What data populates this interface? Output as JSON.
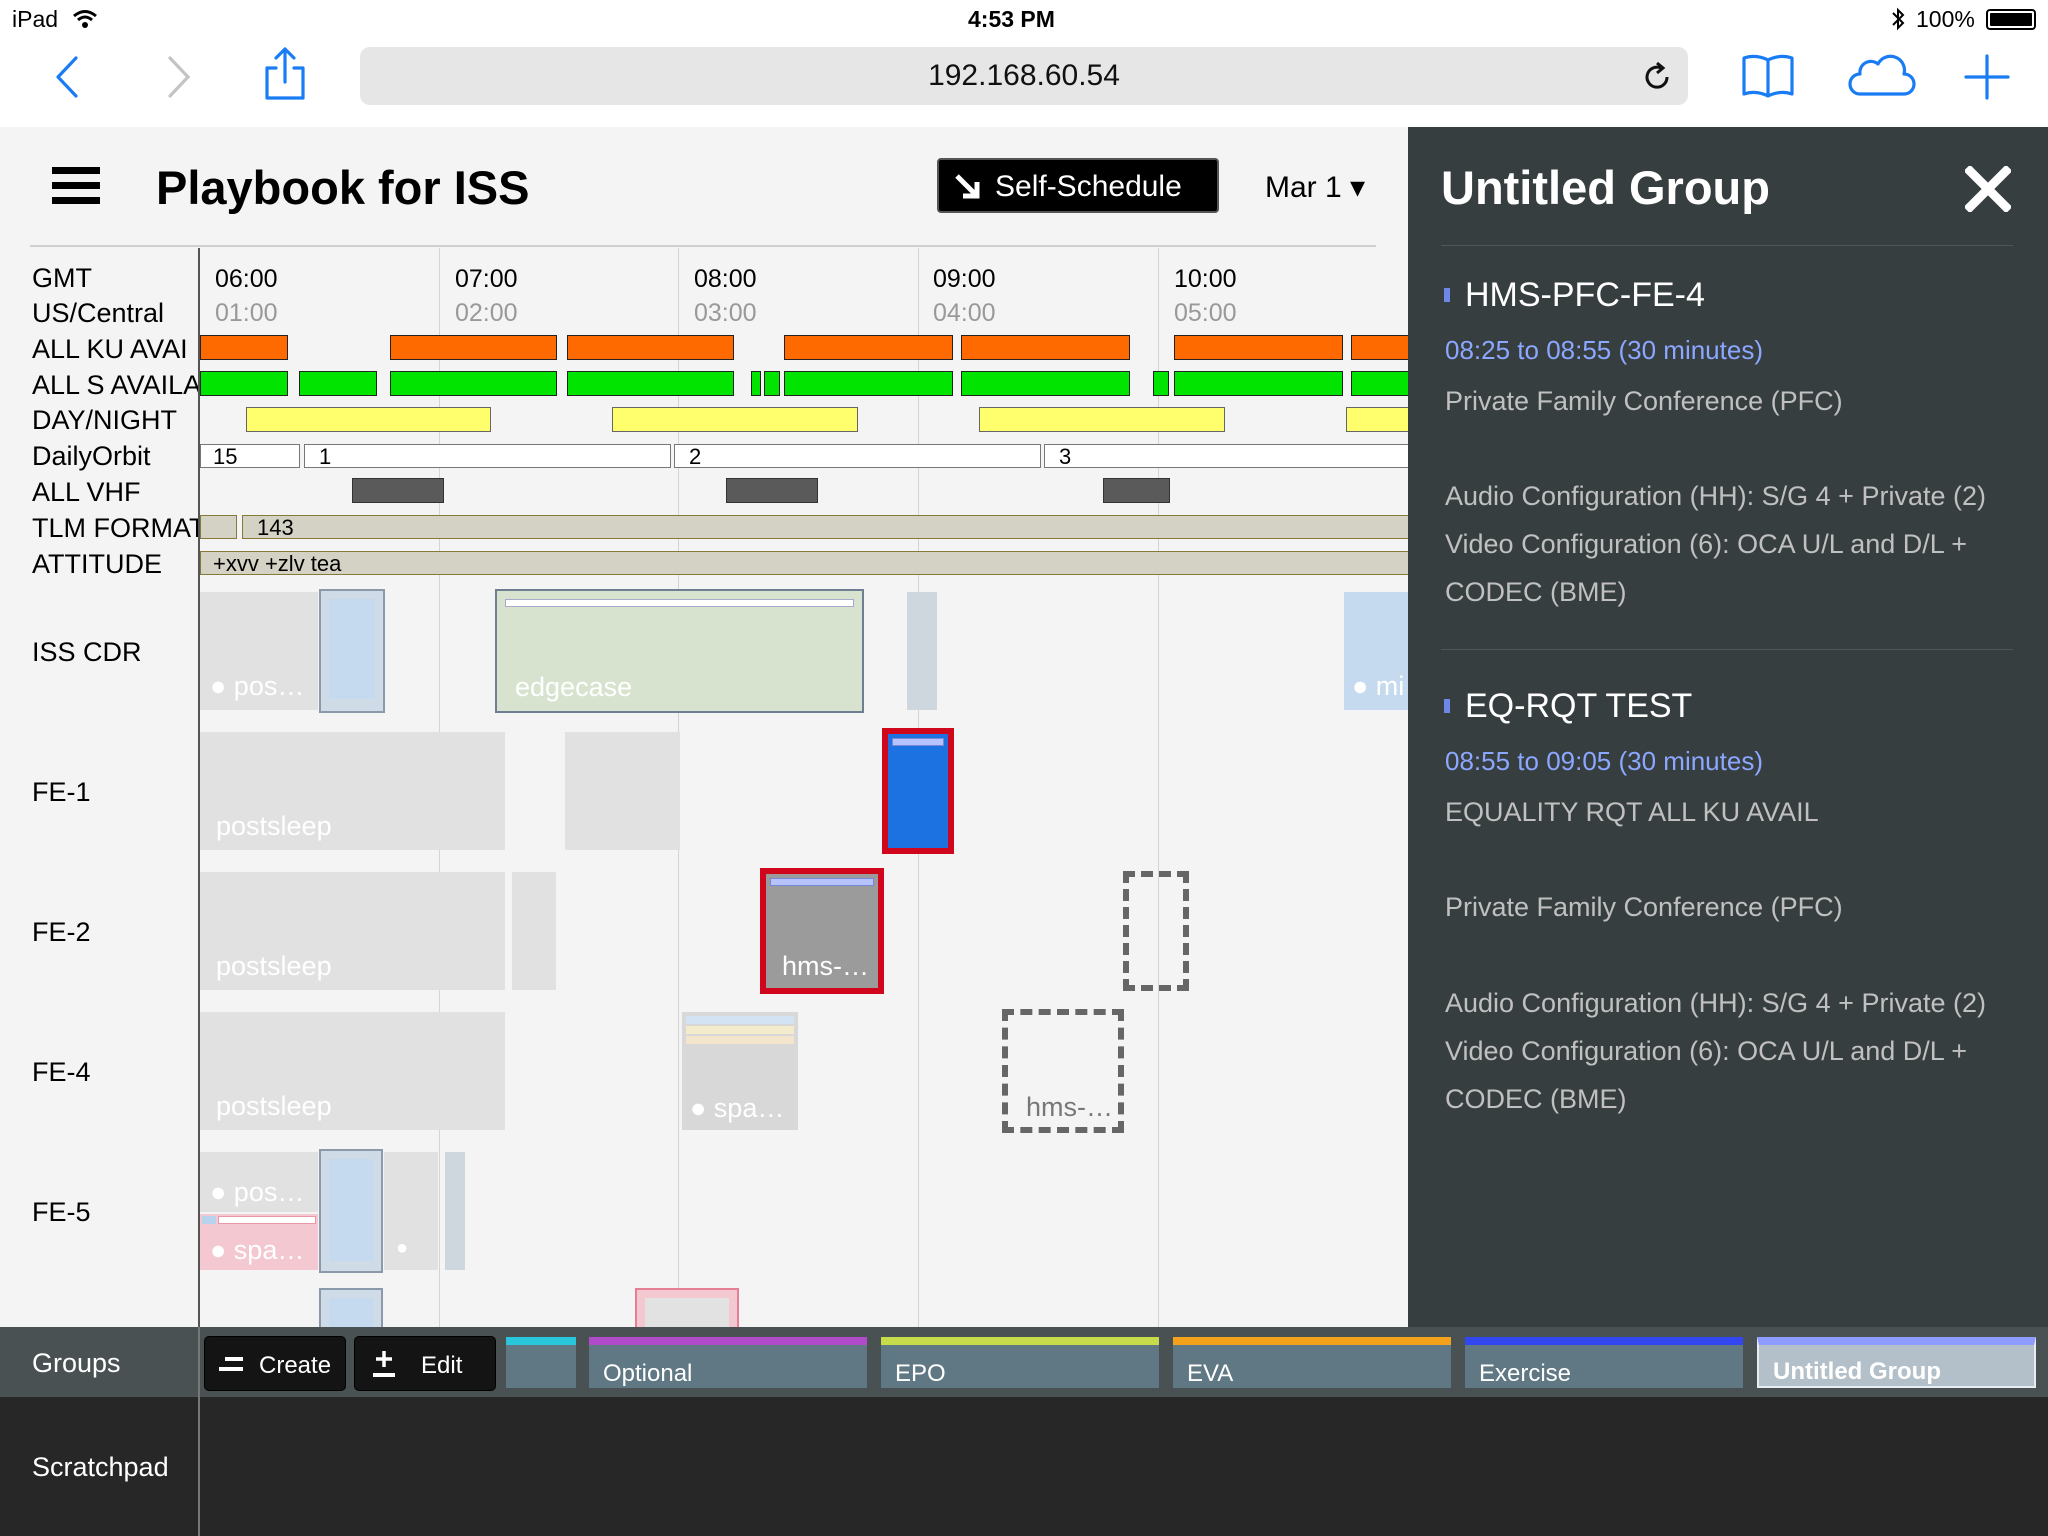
{
  "status_bar": {
    "device": "iPad",
    "time": "4:53 PM",
    "battery": "100%",
    "icons": [
      "wifi-icon",
      "bluetooth-icon",
      "battery-icon"
    ]
  },
  "browser": {
    "url": "192.168.60.54",
    "icons": [
      "back-arrow-icon",
      "forward-arrow-icon",
      "share-icon",
      "reload-icon",
      "bookmarks-icon",
      "cloud-tabs-icon",
      "new-tab-icon"
    ]
  },
  "app": {
    "title": "Playbook for ISS",
    "self_schedule_label": "Self-Schedule",
    "date_label": "Mar 1 ▾",
    "menu_icon": "hamburger-menu-icon"
  },
  "timeline": {
    "row_labels": [
      "GMT",
      "US/Central",
      "ALL KU AVAI",
      "ALL S AVAILA",
      "DAY/NIGHT",
      "DailyOrbit",
      "ALL VHF",
      "TLM FORMAT",
      "ATTITUDE",
      "ISS CDR",
      "FE-1",
      "FE-2",
      "FE-4",
      "FE-5"
    ],
    "gmt_ticks": [
      "06:00",
      "07:00",
      "08:00",
      "09:00",
      "10:00"
    ],
    "central_ticks": [
      "01:00",
      "02:00",
      "03:00",
      "04:00",
      "05:00"
    ],
    "orbit_labels": [
      "15",
      "1",
      "2",
      "3"
    ],
    "tlm_label": "143",
    "attitude_label": "+xvv +zlv tea",
    "activities": {
      "cdr_pos": "● pos…",
      "cdr_edgecase": "edgecase",
      "cdr_mi": "● mi",
      "fe1_postsleep": "postsleep",
      "fe2_postsleep": "postsleep",
      "fe2_hms": "hms-…",
      "fe4_postsleep": "postsleep",
      "fe4_spa": "● spa…",
      "fe4_hms_ghost": "hms-…",
      "fe5_pos": "● pos…",
      "fe5_spa": "● spa…",
      "fe5_dot": "●"
    }
  },
  "panel": {
    "title": "Untitled Group",
    "close_icon": "close-x-icon",
    "items": [
      {
        "name": "HMS-PFC-FE-4",
        "time": "08:25 to 08:55 (30 minutes)",
        "lines": [
          "Private Family Conference (PFC)",
          "",
          "Audio Configuration (HH): S/G 4 + Private (2)",
          "Video Configuration (6): OCA U/L and D/L +",
          "CODEC (BME)"
        ]
      },
      {
        "name": "EQ-RQT TEST",
        "time": "08:55 to 09:05 (30 minutes)",
        "lines": [
          "EQUALITY RQT ALL KU AVAIL",
          "",
          "Private Family Conference (PFC)",
          "",
          "Audio Configuration (HH): S/G 4 + Private (2)",
          "Video Configuration (6): OCA U/L and D/L +",
          "CODEC (BME)"
        ]
      }
    ]
  },
  "groups": {
    "label": "Groups",
    "create_label": "Create",
    "edit_label": "Edit",
    "tabs": [
      {
        "label": "",
        "color": "#2ac6dc"
      },
      {
        "label": "Optional",
        "color": "#b14bc9"
      },
      {
        "label": "EPO",
        "color": "#c6dc4a"
      },
      {
        "label": "EVA",
        "color": "#f4a21c"
      },
      {
        "label": "Exercise",
        "color": "#3347f0"
      },
      {
        "label": "Untitled Group",
        "color": "#8e9cff"
      }
    ]
  },
  "scratchpad": {
    "label": "Scratchpad"
  }
}
